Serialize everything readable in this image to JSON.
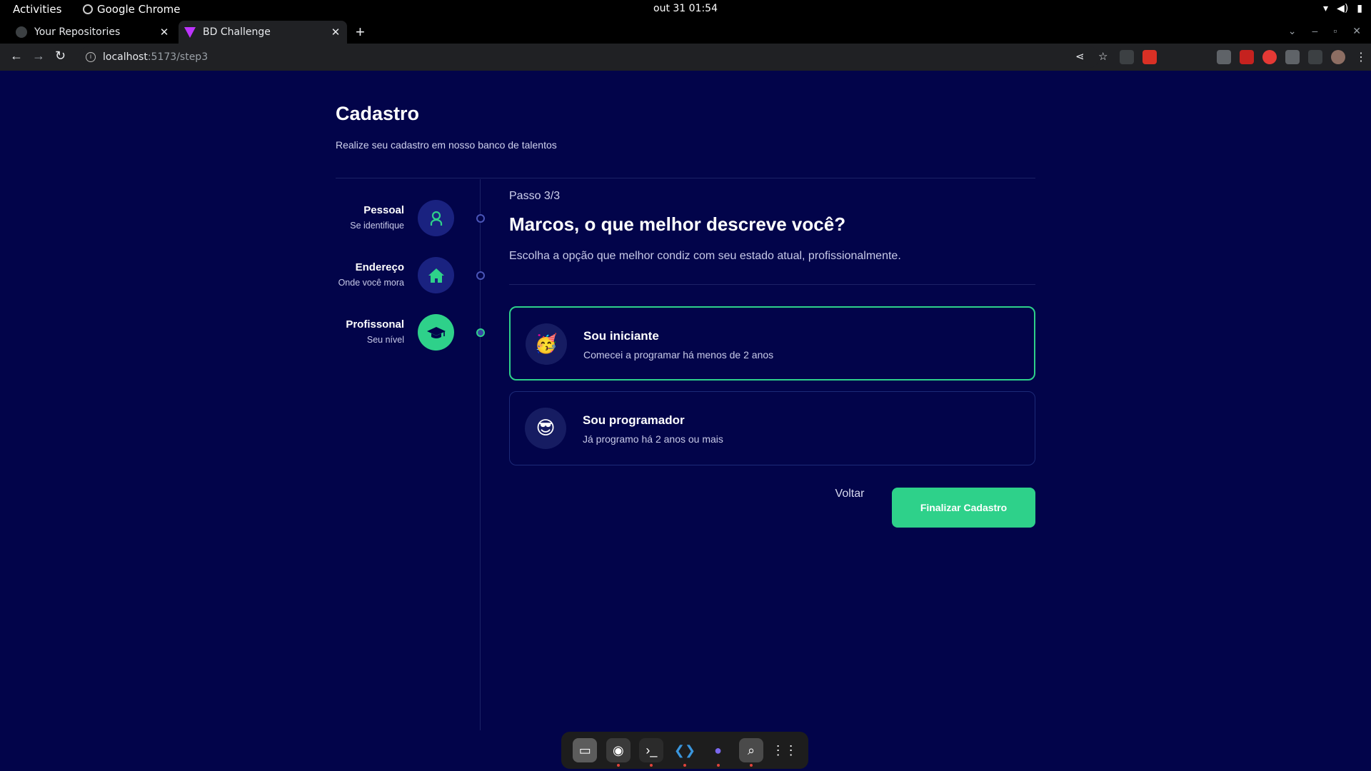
{
  "os": {
    "activities": "Activities",
    "app_name": "Google Chrome",
    "clock": "out 31  01:54"
  },
  "browser": {
    "tabs": [
      {
        "title": "Your Repositories",
        "favicon": "github-icon",
        "active": false
      },
      {
        "title": "BD Challenge",
        "favicon": "vite-icon",
        "active": true
      }
    ],
    "url_host": "localhost",
    "url_path": ":5173/step3"
  },
  "page": {
    "title": "Cadastro",
    "subtitle": "Realize seu cadastro em nosso banco de talentos",
    "steps": [
      {
        "label": "Pessoal",
        "desc": "Se identifique",
        "icon": "user-icon",
        "active": false
      },
      {
        "label": "Endereço",
        "desc": "Onde você mora",
        "icon": "house-icon",
        "active": false
      },
      {
        "label": "Profissonal",
        "desc": "Seu nível",
        "icon": "graduation-cap-icon",
        "active": true
      }
    ],
    "step_counter": "Passo 3/3",
    "question": "Marcos, o que melhor descreve você?",
    "question_sub": "Escolha a opção que melhor condiz com seu estado atual, profissionalmente.",
    "options": [
      {
        "emoji": "🥳",
        "title": "Sou iniciante",
        "subtitle": "Comecei a programar há menos de 2 anos",
        "selected": true
      },
      {
        "emoji": "😎",
        "title": "Sou programador",
        "subtitle": "Já programo há 2 anos ou mais",
        "selected": false
      }
    ],
    "back_label": "Voltar",
    "finish_label": "Finalizar Cadastro"
  },
  "colors": {
    "background": "#02044a",
    "accent": "#2ed18a",
    "step_circle": "#1a2280"
  }
}
